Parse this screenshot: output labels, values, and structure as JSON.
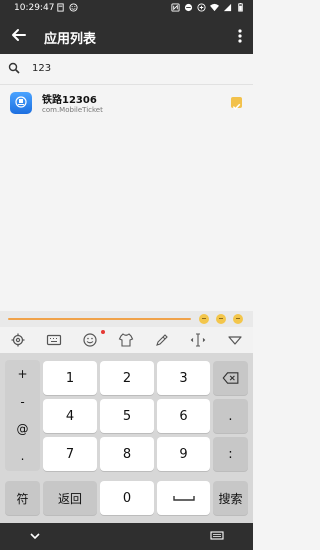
{
  "status_bar": {
    "time": "10:29:47",
    "left_icons": [
      "storage-icon",
      "emoji-icon"
    ],
    "right_icons": [
      "nfc-icon",
      "dnd-icon",
      "data-saver-icon",
      "wifi-icon",
      "signal-icon",
      "battery-icon"
    ]
  },
  "app_bar": {
    "title": "应用列表",
    "back_icon": "arrow-left",
    "more_icon": "more-vertical"
  },
  "search": {
    "icon": "search",
    "value": "123"
  },
  "apps": [
    {
      "name": "铁路12306",
      "package": "com.MobileTicket",
      "checked": true
    }
  ],
  "keyboard": {
    "toolbar_icons": [
      "gear-icon",
      "keyboard-icon",
      "emoji-icon",
      "shirt-icon",
      "pen-icon",
      "cursor-icon",
      "triangle-down-icon"
    ],
    "side_keys": [
      "+",
      "-",
      "@",
      "."
    ],
    "rows": [
      [
        "1",
        "2",
        "3"
      ],
      [
        "4",
        "5",
        "6"
      ],
      [
        "7",
        "8",
        "9"
      ]
    ],
    "right_keys": [
      ".",
      ":"
    ],
    "bottom": {
      "symbol": "符",
      "back": "返回",
      "zero": "0",
      "search": "搜索"
    }
  },
  "colors": {
    "bar": "#2f2f2f",
    "accent_yellow": "#f2c14b",
    "orange_line": "#f0a24a"
  }
}
